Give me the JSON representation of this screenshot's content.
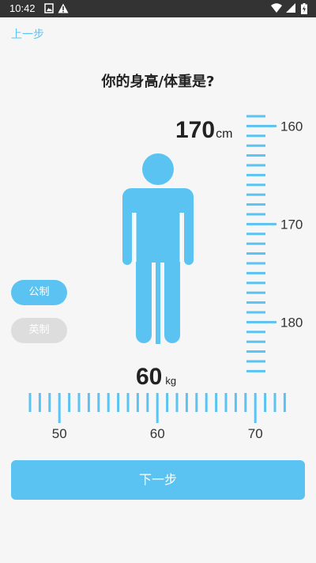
{
  "status_bar": {
    "time": "10:42"
  },
  "nav": {
    "back_label": "上一步"
  },
  "title": "你的身高/体重是?",
  "height": {
    "value": "170",
    "unit": "cm",
    "ruler_labels": [
      "160",
      "170",
      "180"
    ]
  },
  "weight": {
    "value": "60",
    "unit": "kg",
    "ruler_labels": [
      "50",
      "60",
      "70"
    ]
  },
  "units_toggle": {
    "metric_label": "公制",
    "imperial_label": "英制",
    "selected": "metric"
  },
  "next_button": {
    "label": "下一步"
  },
  "colors": {
    "accent": "#5bc3f2",
    "inactive": "#dddddd",
    "text": "#222222",
    "background": "#f6f6f6",
    "status_bar": "#333333"
  },
  "icons": [
    "photo-icon",
    "warning-icon",
    "wifi-icon",
    "signal-icon",
    "battery-icon",
    "person-figure-icon"
  ]
}
